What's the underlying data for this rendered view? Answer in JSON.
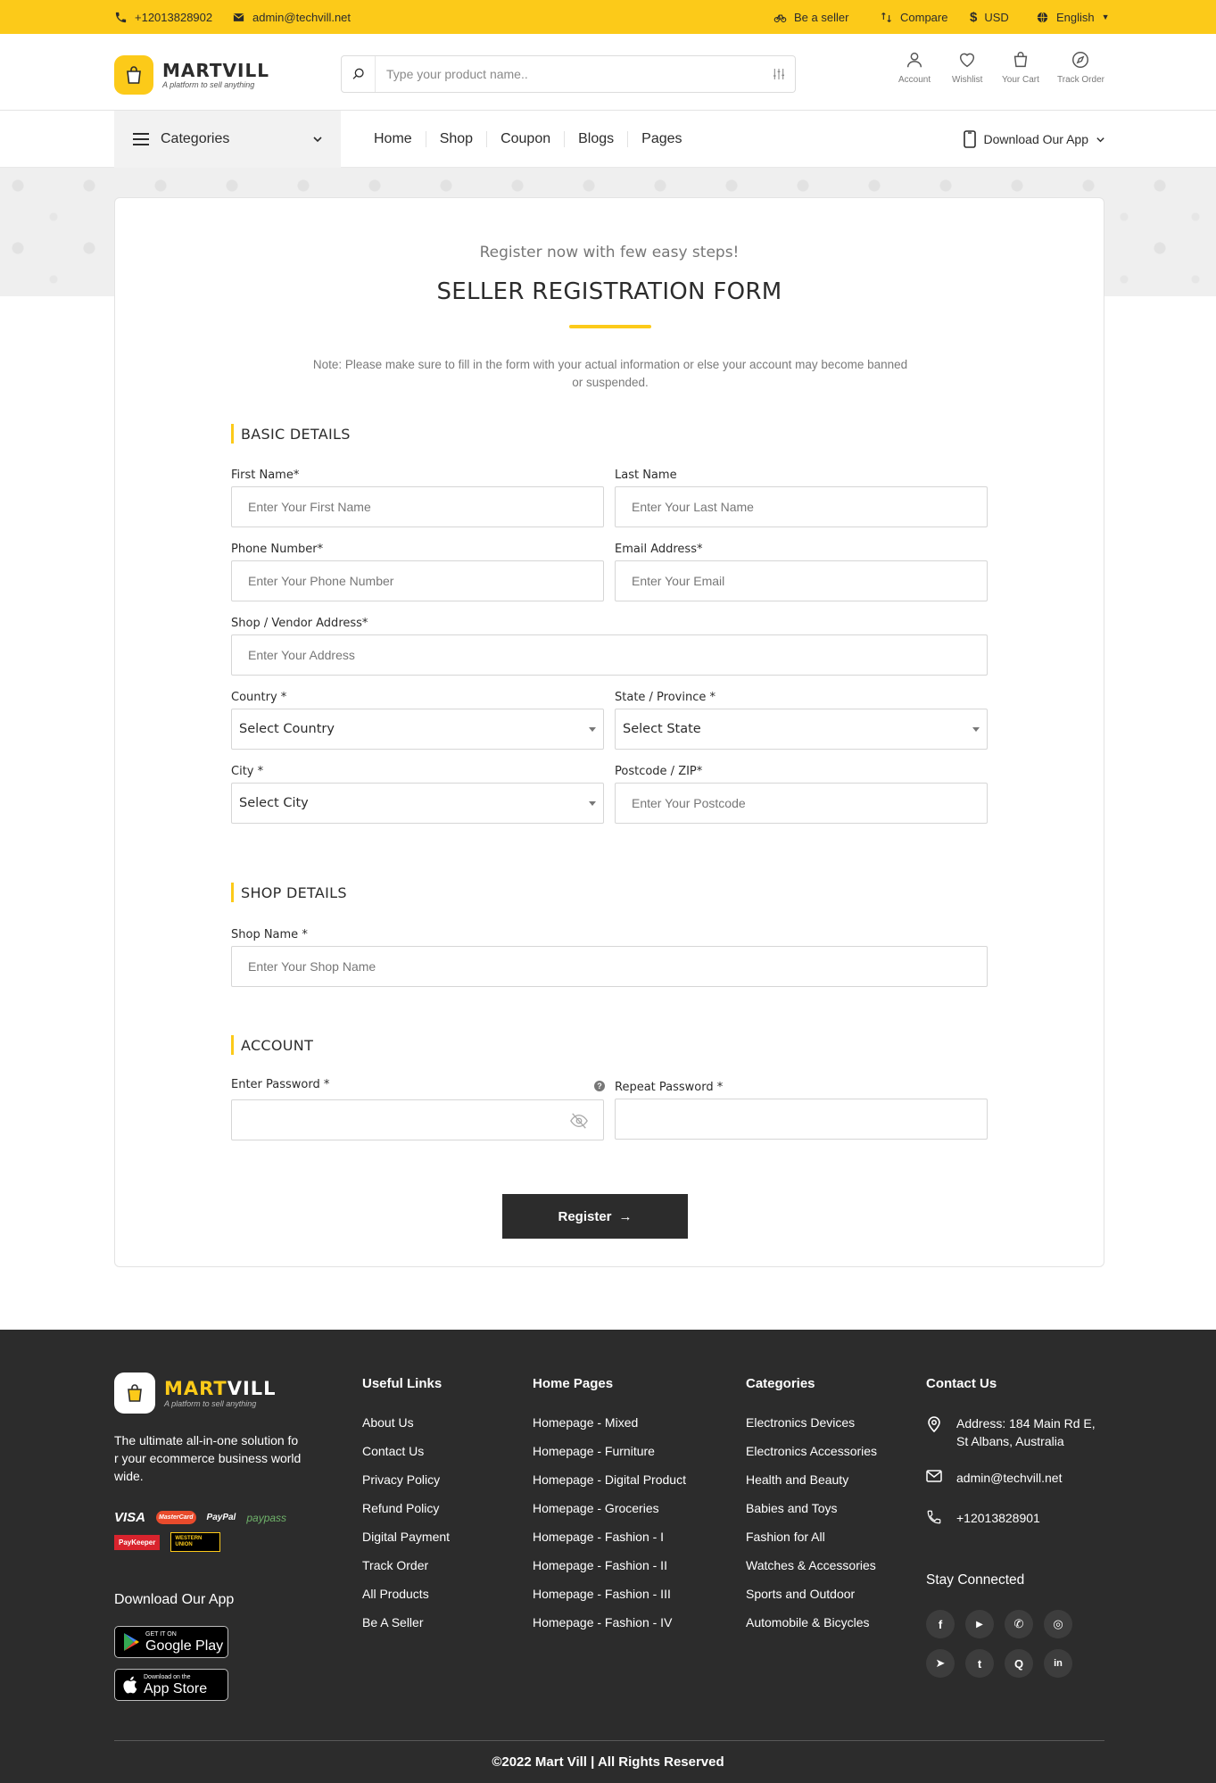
{
  "topbar": {
    "phone": "+12013828902",
    "email": "admin@techvill.net",
    "be_seller": "Be a seller",
    "compare": "Compare",
    "currency": "USD",
    "language": "English"
  },
  "header": {
    "brand": "MARTVILL",
    "tagline": "A platform to sell anything",
    "search_placeholder": "Type your product name..",
    "icons": {
      "account": "Account",
      "wishlist": "Wishlist",
      "cart": "Your Cart",
      "track": "Track Order"
    }
  },
  "nav": {
    "categories": "Categories",
    "links": [
      "Home",
      "Shop",
      "Coupon",
      "Blogs",
      "Pages"
    ],
    "download_app": "Download Our App"
  },
  "form": {
    "subhead": "Register now with few easy steps!",
    "title": "SELLER REGISTRATION FORM",
    "note": "Note: Please make sure to fill in the form with your actual information or else your account may become banned or suspended.",
    "sections": {
      "basic": "BASIC DETAILS",
      "shop": "SHOP DETAILS",
      "account": "ACCOUNT"
    },
    "first_name": {
      "label": "First Name*",
      "placeholder": "Enter Your First Name"
    },
    "last_name": {
      "label": "Last Name",
      "placeholder": "Enter Your Last Name"
    },
    "phone": {
      "label": "Phone Number*",
      "placeholder": "Enter Your Phone Number"
    },
    "email": {
      "label": "Email Address*",
      "placeholder": "Enter Your Email"
    },
    "address": {
      "label": "Shop / Vendor Address*",
      "placeholder": "Enter Your Address"
    },
    "country": {
      "label": "Country *",
      "value": "Select Country"
    },
    "state": {
      "label": "State / Province *",
      "value": "Select State"
    },
    "city": {
      "label": "City *",
      "value": "Select City"
    },
    "postcode": {
      "label": "Postcode / ZIP*",
      "placeholder": "Enter Your Postcode"
    },
    "shop_name": {
      "label": "Shop Name *",
      "placeholder": "Enter Your Shop Name"
    },
    "password": {
      "label": "Enter Password *"
    },
    "repeat_password": {
      "label": "Repeat Password *"
    },
    "register": "Register",
    "register_arrow": "→"
  },
  "footer": {
    "brand_part1": "MART",
    "brand_part2": "VILL",
    "tagline": "A platform to sell anything",
    "description": "The ultimate all-in-one solution for your ecommerce business worldwide.",
    "payments": [
      "VISA",
      "MasterCard",
      "PayPal",
      "paypass",
      "PayKeeper",
      "WESTERN UNION"
    ],
    "download_title": "Download Our App",
    "google_small": "GET IT ON",
    "google_big": "Google Play",
    "apple_small": "Download on the",
    "apple_big": "App Store",
    "useful_links": {
      "title": "Useful Links",
      "items": [
        "About Us",
        "Contact Us",
        "Privacy Policy",
        "Refund Policy",
        "Digital Payment",
        "Track Order",
        "All Products",
        "Be A Seller"
      ]
    },
    "home_pages": {
      "title": "Home Pages",
      "items": [
        "Homepage - Mixed",
        "Homepage - Furniture",
        "Homepage - Digital Product",
        "Homepage - Groceries",
        "Homepage - Fashion - I",
        "Homepage - Fashion - II",
        "Homepage - Fashion - III",
        "Homepage - Fashion - IV"
      ]
    },
    "categories": {
      "title": "Categories",
      "items": [
        "Electronics Devices",
        "Electronics Accessories",
        "Health and Beauty",
        "Babies and Toys",
        "Fashion for All",
        "Watches & Accessories",
        "Sports and Outdoor",
        "Automobile & Bicycles"
      ]
    },
    "contact": {
      "title": "Contact Us",
      "address": "Address: 184 Main Rd E, St Albans, Australia",
      "email": "admin@techvill.net",
      "phone": "+12013828901"
    },
    "stay_connected": "Stay Connected",
    "social_glyphs": [
      "f",
      "▶",
      "✆",
      "◎",
      "➤",
      "t",
      "Q",
      "in"
    ],
    "copyright": "©2022 Mart Vill | All Rights Reserved"
  },
  "colors": {
    "accent": "#fcca19",
    "dark": "#2c2c2c"
  }
}
